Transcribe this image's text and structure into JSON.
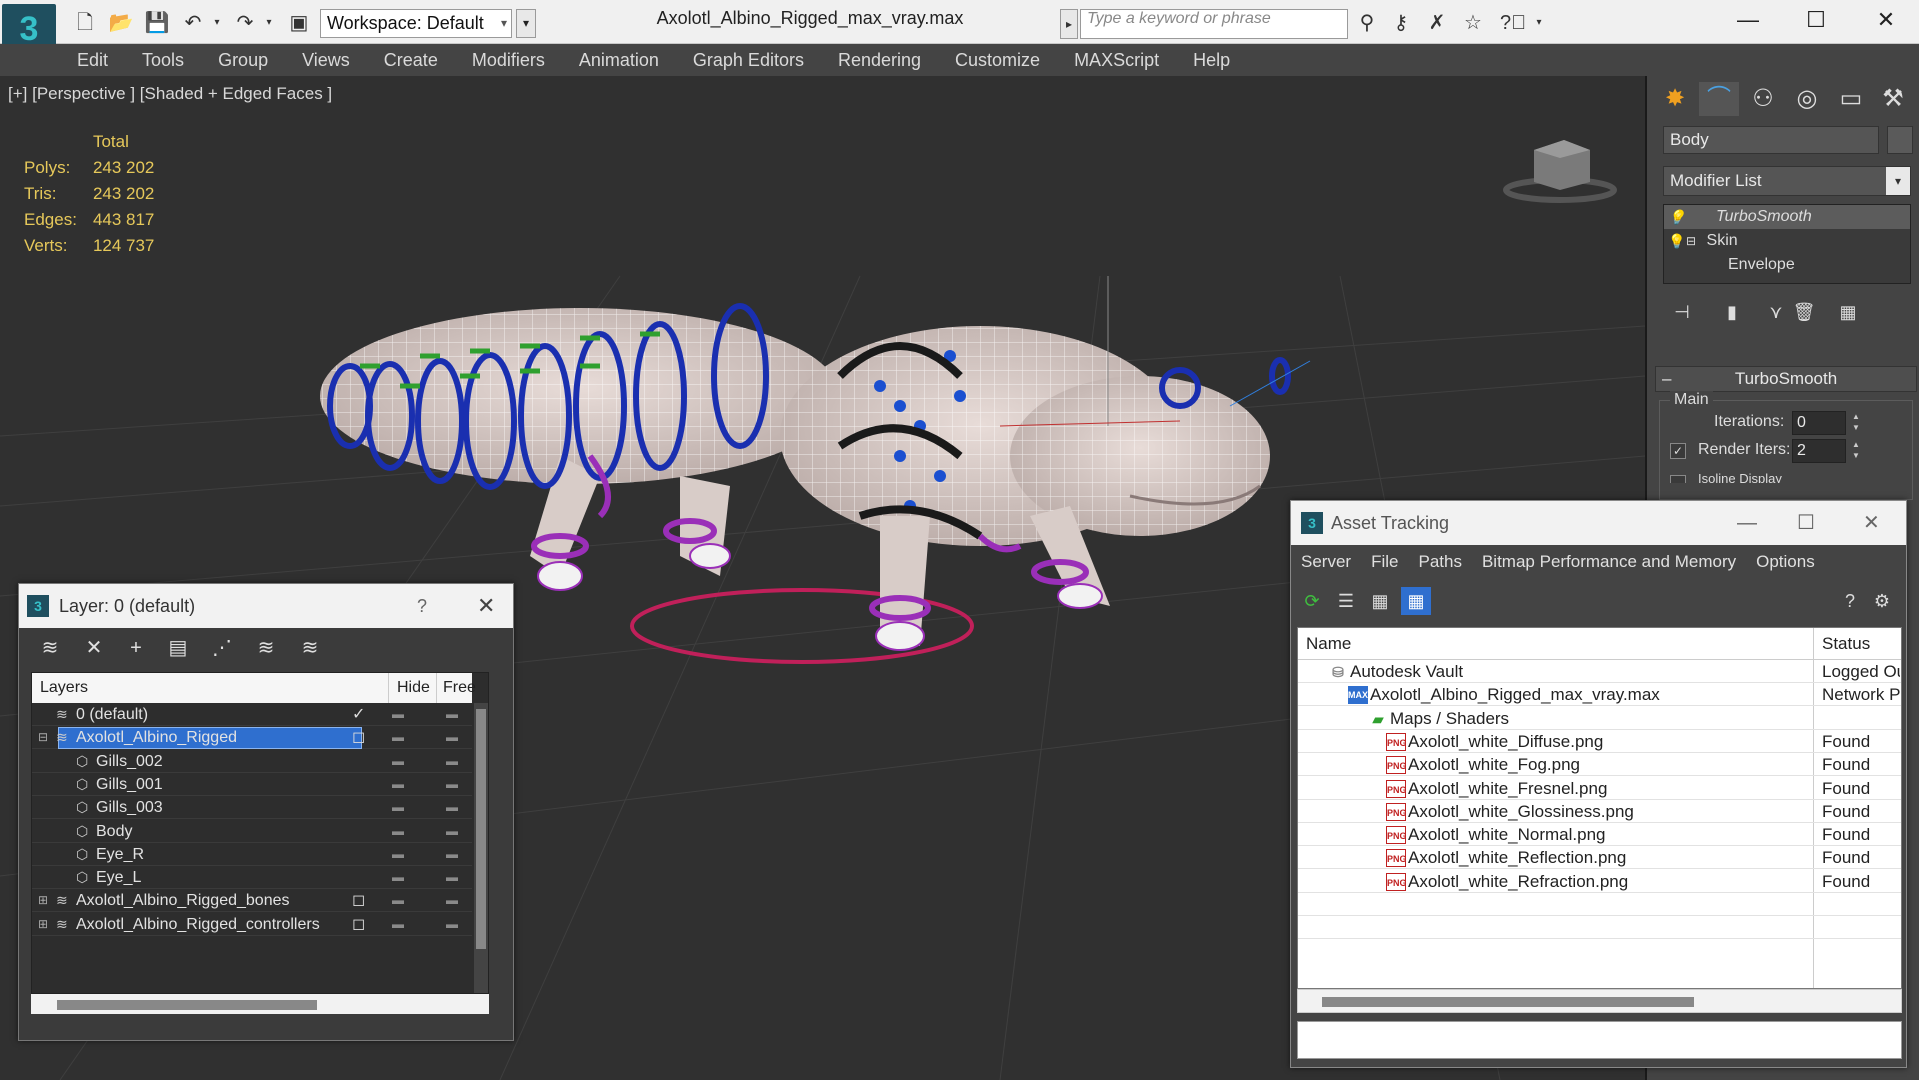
{
  "app": {
    "title": "Axolotl_Albino_Rigged_max_vray.max",
    "workspace": "Workspace: Default",
    "search_placeholder": "Type a keyword or phrase"
  },
  "menu": [
    "Edit",
    "Tools",
    "Group",
    "Views",
    "Create",
    "Modifiers",
    "Animation",
    "Graph Editors",
    "Rendering",
    "Customize",
    "MAXScript",
    "Help"
  ],
  "viewport": {
    "label": "[+] [Perspective ] [Shaded + Edged Faces ]",
    "stats": {
      "header": "Total",
      "rows": [
        {
          "label": "Polys:",
          "value": "243 202"
        },
        {
          "label": "Tris:",
          "value": "243 202"
        },
        {
          "label": "Edges:",
          "value": "443 817"
        },
        {
          "label": "Verts:",
          "value": "124 737"
        }
      ]
    }
  },
  "command_panel": {
    "object_name": "Body",
    "modifier_list": "Modifier List",
    "stack": [
      {
        "label": "TurboSmooth",
        "selected": true
      },
      {
        "label": "Skin",
        "selected": false
      },
      {
        "label": "Envelope",
        "selected": false
      }
    ],
    "rollout": {
      "title": "TurboSmooth",
      "group": "Main",
      "iterations_label": "Iterations:",
      "iterations_value": "0",
      "render_iters_label": "Render Iters:",
      "render_iters_value": "2",
      "isoline_label": "Isoline Display"
    }
  },
  "layer_window": {
    "title": "Layer: 0 (default)",
    "help": "?",
    "columns": {
      "layers": "Layers",
      "hide": "Hide",
      "freeze": "Free"
    },
    "rows": [
      {
        "name": "0 (default)",
        "indent": 1,
        "type": "layer",
        "current": true
      },
      {
        "name": "Axolotl_Albino_Rigged",
        "indent": 1,
        "type": "layer",
        "selected": true,
        "expanded": true
      },
      {
        "name": "Gills_002",
        "indent": 2,
        "type": "object"
      },
      {
        "name": "Gills_001",
        "indent": 2,
        "type": "object"
      },
      {
        "name": "Gills_003",
        "indent": 2,
        "type": "object"
      },
      {
        "name": "Body",
        "indent": 2,
        "type": "object"
      },
      {
        "name": "Eye_R",
        "indent": 2,
        "type": "object"
      },
      {
        "name": "Eye_L",
        "indent": 2,
        "type": "object"
      },
      {
        "name": "Axolotl_Albino_Rigged_bones",
        "indent": 1,
        "type": "layer",
        "collapsed": true
      },
      {
        "name": "Axolotl_Albino_Rigged_controllers",
        "indent": 1,
        "type": "layer",
        "collapsed": true
      }
    ]
  },
  "asset_window": {
    "title": "Asset Tracking",
    "menu": [
      "Server",
      "File",
      "Paths",
      "Bitmap Performance and Memory",
      "Options"
    ],
    "columns": {
      "name": "Name",
      "status": "Status"
    },
    "rows": [
      {
        "name": "Autodesk Vault",
        "indent": 0,
        "icon": "vault",
        "status": "Logged Ou"
      },
      {
        "name": "Axolotl_Albino_Rigged_max_vray.max",
        "indent": 1,
        "icon": "max",
        "status": "Network Pa"
      },
      {
        "name": "Maps / Shaders",
        "indent": 2,
        "icon": "maps",
        "status": ""
      },
      {
        "name": "Axolotl_white_Diffuse.png",
        "indent": 3,
        "icon": "png",
        "status": "Found"
      },
      {
        "name": "Axolotl_white_Fog.png",
        "indent": 3,
        "icon": "png",
        "status": "Found"
      },
      {
        "name": "Axolotl_white_Fresnel.png",
        "indent": 3,
        "icon": "png",
        "status": "Found"
      },
      {
        "name": "Axolotl_white_Glossiness.png",
        "indent": 3,
        "icon": "png",
        "status": "Found"
      },
      {
        "name": "Axolotl_white_Normal.png",
        "indent": 3,
        "icon": "png",
        "status": "Found"
      },
      {
        "name": "Axolotl_white_Reflection.png",
        "indent": 3,
        "icon": "png",
        "status": "Found"
      },
      {
        "name": "Axolotl_white_Refraction.png",
        "indent": 3,
        "icon": "png",
        "status": "Found"
      }
    ],
    "png_badge": "PNG",
    "max_badge": "MAX"
  },
  "colors": {
    "accent_select": "#2f6fcf",
    "stats_yellow": "#e6c85a",
    "bone_blue": "#1a2fb0",
    "ctrl_purple": "#9a2fb8",
    "ctrl_green": "#2fa02f",
    "ground_ring": "#c0205a"
  }
}
